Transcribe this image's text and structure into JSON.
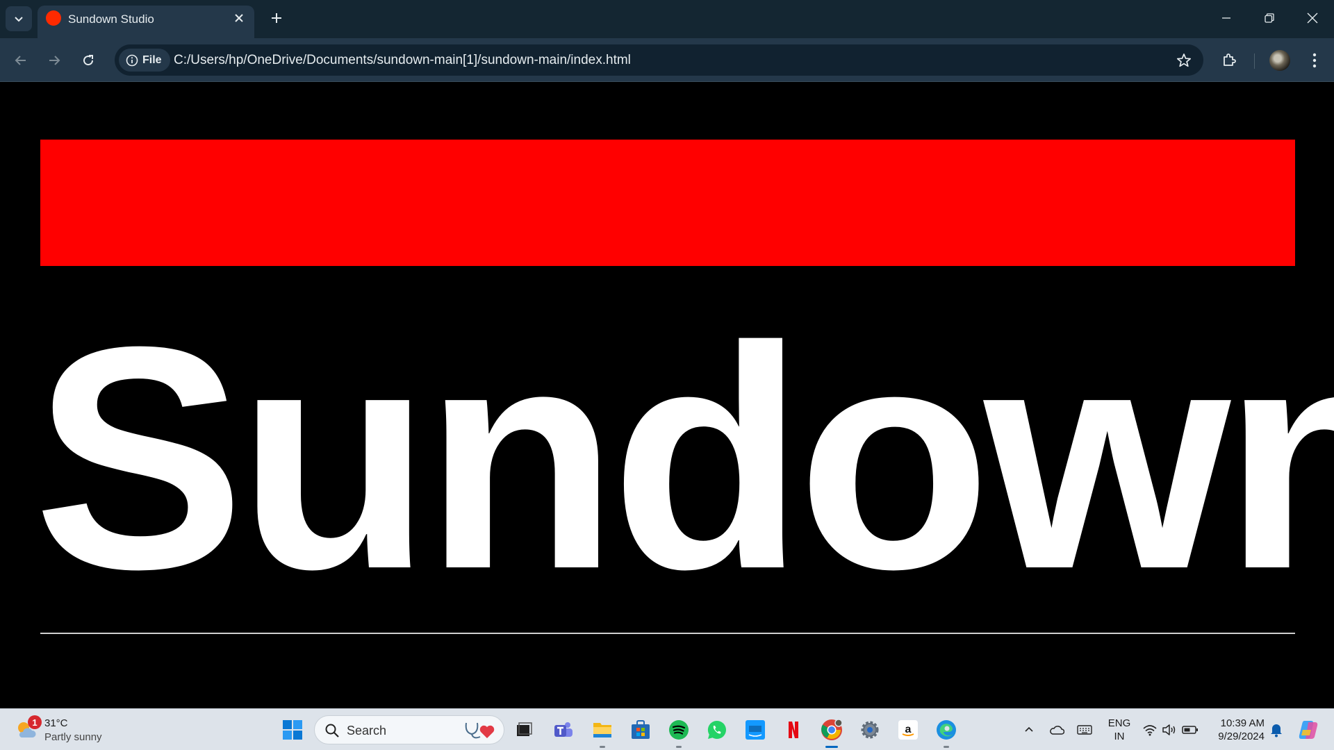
{
  "browser": {
    "tab": {
      "title": "Sundown Studio",
      "favicon_color": "#ff2a00"
    },
    "address": {
      "scheme_label": "File",
      "url": "C:/Users/hp/OneDrive/Documents/sundown-main[1]/sundown-main/index.html"
    },
    "icons": [
      "tab-search-icon",
      "close-icon",
      "plus-icon",
      "minimize-icon",
      "restore-icon",
      "window-close-icon",
      "back-icon",
      "forward-icon",
      "reload-icon",
      "info-icon",
      "star-icon",
      "extensions-icon",
      "profile-avatar",
      "more-vert-icon"
    ]
  },
  "page": {
    "hero_bar_color": "#ff0000",
    "hero_title": "Sundown",
    "background": "#000000",
    "text_color": "#ffffff"
  },
  "taskbar": {
    "weather": {
      "badge": "1",
      "temp": "31°C",
      "condition": "Partly sunny"
    },
    "search": {
      "placeholder": "Search"
    },
    "apps": [
      "start",
      "search",
      "task-view",
      "teams",
      "file-explorer",
      "microsoft-store",
      "spotify",
      "whatsapp",
      "prime-video",
      "netflix",
      "chrome",
      "settings",
      "amazon",
      "edge"
    ],
    "active_app": "chrome",
    "tray": {
      "language": "ENG",
      "region": "IN",
      "time": "10:39 AM",
      "date": "9/29/2024"
    }
  }
}
